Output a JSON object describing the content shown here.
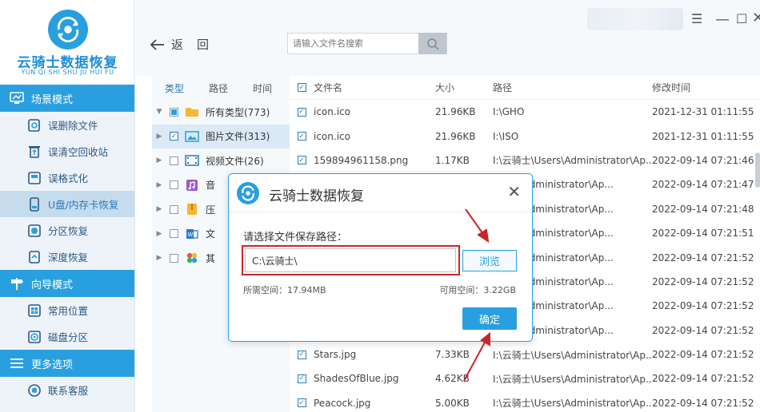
{
  "app": {
    "name": "云骑士数据恢复",
    "name_en": "YUN QI SHI SHU JU HUI FU"
  },
  "sidebar": {
    "sections": [
      {
        "title": "场景模式",
        "items": [
          {
            "label": "误删除文件"
          },
          {
            "label": "误清空回收站"
          },
          {
            "label": "误格式化"
          },
          {
            "label": "U盘/内存卡恢复"
          },
          {
            "label": "分区恢复"
          },
          {
            "label": "深度恢复"
          }
        ]
      },
      {
        "title": "向导模式",
        "items": [
          {
            "label": "常用位置"
          },
          {
            "label": "磁盘分区"
          }
        ]
      },
      {
        "title": "更多选项",
        "items": [
          {
            "label": "联系客服"
          }
        ]
      }
    ]
  },
  "toolbar": {
    "back_label": "返",
    "home_label": "回",
    "search_placeholder": "请输入文件名搜索"
  },
  "tree": {
    "tabs": [
      "类型",
      "路径",
      "时间"
    ],
    "rows": [
      {
        "label": "所有类型(773)"
      },
      {
        "label": "图片文件(313)"
      },
      {
        "label": "视频文件(26)"
      },
      {
        "label": "音"
      },
      {
        "label": "压"
      },
      {
        "label": "文"
      },
      {
        "label": "其"
      }
    ]
  },
  "file_list": {
    "headers": {
      "name": "文件名",
      "size": "大小",
      "path": "路径",
      "time": "修改时间"
    },
    "rows": [
      {
        "name": "icon.ico",
        "size": "21.96KB",
        "path": "I:\\GHO",
        "time": "2021-12-31 01:11:55"
      },
      {
        "name": "icon.ico",
        "size": "21.96KB",
        "path": "I:\\ISO",
        "time": "2021-12-31 01:11:55"
      },
      {
        "name": "159894961158.png",
        "size": "1.17KB",
        "path": "I:\\云骑士\\Users\\Administrator\\Ap...",
        "time": "2022-09-14 07:21:46"
      },
      {
        "name": "",
        "size": "",
        "path": "Users\\Administrator\\Ap...",
        "time": "2022-09-14 07:21:47"
      },
      {
        "name": "",
        "size": "",
        "path": "Users\\Administrator\\Ap...",
        "time": "2022-09-14 07:21:48"
      },
      {
        "name": "",
        "size": "",
        "path": "Users\\Administrator\\Ap...",
        "time": "2022-09-14 07:21:51"
      },
      {
        "name": "",
        "size": "",
        "path": "Users\\Administrator\\Ap...",
        "time": "2022-09-14 07:21:52"
      },
      {
        "name": "",
        "size": "",
        "path": "Users\\Administrator\\Ap...",
        "time": "2022-09-14 07:21:52"
      },
      {
        "name": "",
        "size": "",
        "path": "Users\\Administrator\\Ap...",
        "time": "2022-09-14 07:21:52"
      },
      {
        "name": "",
        "size": "",
        "path": "Users\\Administrator\\Ap...",
        "time": "2022-09-14 07:21:52"
      },
      {
        "name": "Stars.jpg",
        "size": "7.33KB",
        "path": "I:\\云骑士\\Users\\Administrator\\Ap...",
        "time": "2022-09-14 07:21:52"
      },
      {
        "name": "ShadesOfBlue.jpg",
        "size": "4.62KB",
        "path": "I:\\云骑士\\Users\\Administrator\\Ap...",
        "time": "2022-09-14 07:21:52"
      },
      {
        "name": "Peacock.jpg",
        "size": "5.00KB",
        "path": "I:\\云骑士\\Users\\Administrator\\Ap...",
        "time": "2022-09-14 07:21:52"
      }
    ]
  },
  "dialog": {
    "title": "云骑士数据恢复",
    "prompt": "请选择文件保存路径：",
    "path_value": "C:\\云骑士\\",
    "browse_label": "浏览",
    "required_space": "所需空间：17.94MB",
    "available_space": "可用空间：3.22GB",
    "ok_label": "确定"
  },
  "colors": {
    "accent": "#2a9fe0",
    "highlight_box": "#c9262a"
  }
}
